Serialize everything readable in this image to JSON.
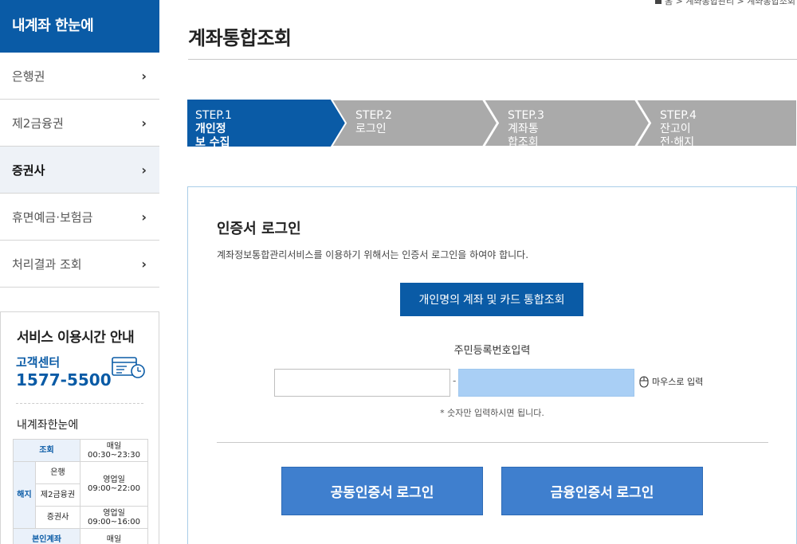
{
  "sidebar": {
    "title": "내계좌 한눈에",
    "items": [
      {
        "label": "은행권"
      },
      {
        "label": "제2금융권"
      },
      {
        "label": "증권사"
      },
      {
        "label": "휴면예금·보험금"
      },
      {
        "label": "처리결과 조회"
      }
    ],
    "active_index": 2,
    "info": {
      "title": "서비스 이용시간 안내",
      "cs_label": "고객센터",
      "cs_phone": "1577-5500",
      "sub_title": "내계좌한눈에",
      "hours": {
        "inquiry_label": "조회",
        "inquiry_days": "매일",
        "inquiry_time": "00:30~23:30",
        "cancel_label": "해지",
        "bank_label": "은행",
        "bank_days": "영업일",
        "bank_time": "09:00~22:00",
        "second_fin_label": "제2금융권",
        "securities_label": "증권사",
        "securities_days": "영업일",
        "securities_time": "09:00~16:00",
        "own_account_label": "본인계좌",
        "own_account_days": "매일"
      }
    }
  },
  "breadcrumb": {
    "text": "홈 > 계좌통합관리 > 계좌통합조회"
  },
  "page_title": "계좌통합조회",
  "steps": [
    {
      "step": "STEP.1",
      "label": "개인정보 수집 및 이용동의",
      "active": true
    },
    {
      "step": "STEP.2",
      "label": "로그인",
      "active": false
    },
    {
      "step": "STEP.3",
      "label": "계좌통합조회",
      "active": false
    },
    {
      "step": "STEP.4",
      "label": "잔고이전·해지",
      "active": false
    }
  ],
  "panel": {
    "title": "인증서 로그인",
    "description": "계좌정보통합관리서비스를 이용하기 위해서는 인증서 로그인을 하여야 합니다.",
    "integrated_button": "개인명의 계좌 및 카드 통합조회",
    "rrn_label": "주민등록번호입력",
    "rrn_front_value": "",
    "rrn_back_value": "",
    "rrn_separator": "-",
    "mouse_input_label": "마우스로 입력",
    "hint": "* 숫자만 입력하시면 됩니다.",
    "joint_cert_button": "공동인증서 로그인",
    "financial_cert_button": "금융인증서 로그인"
  },
  "colors": {
    "brand": "#0a5ba6",
    "step_inactive": "#aaaaaa",
    "login_button": "#3f7fce",
    "rrn_back_field": "#a9cff5"
  },
  "icons": {
    "chevron": "chevron-right-icon",
    "customer_center": "customer-center-card-clock-icon",
    "mouse": "mouse-icon"
  }
}
